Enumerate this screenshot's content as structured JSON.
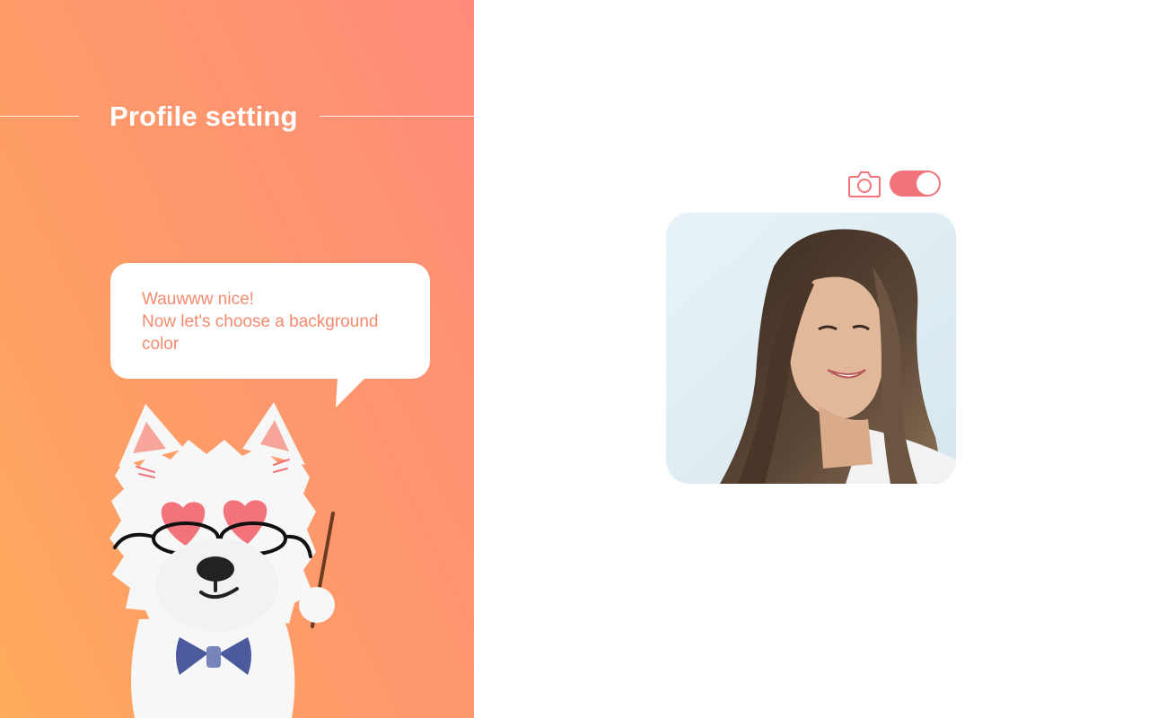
{
  "header": {
    "title": "Profile setting"
  },
  "speech_bubble": {
    "lines": [
      "Wauwww nice!",
      "Now let's choose a background",
      "color"
    ]
  },
  "mascot": {
    "name": "dog-mascot-icon"
  },
  "photo_controls": {
    "camera_icon": "camera-icon",
    "toggle_on": true
  },
  "colors": {
    "gradient_start": "#ffab5c",
    "gradient_end": "#ff8a7a",
    "accent": "#f2737a",
    "bubble_text": "#f48a6e"
  }
}
